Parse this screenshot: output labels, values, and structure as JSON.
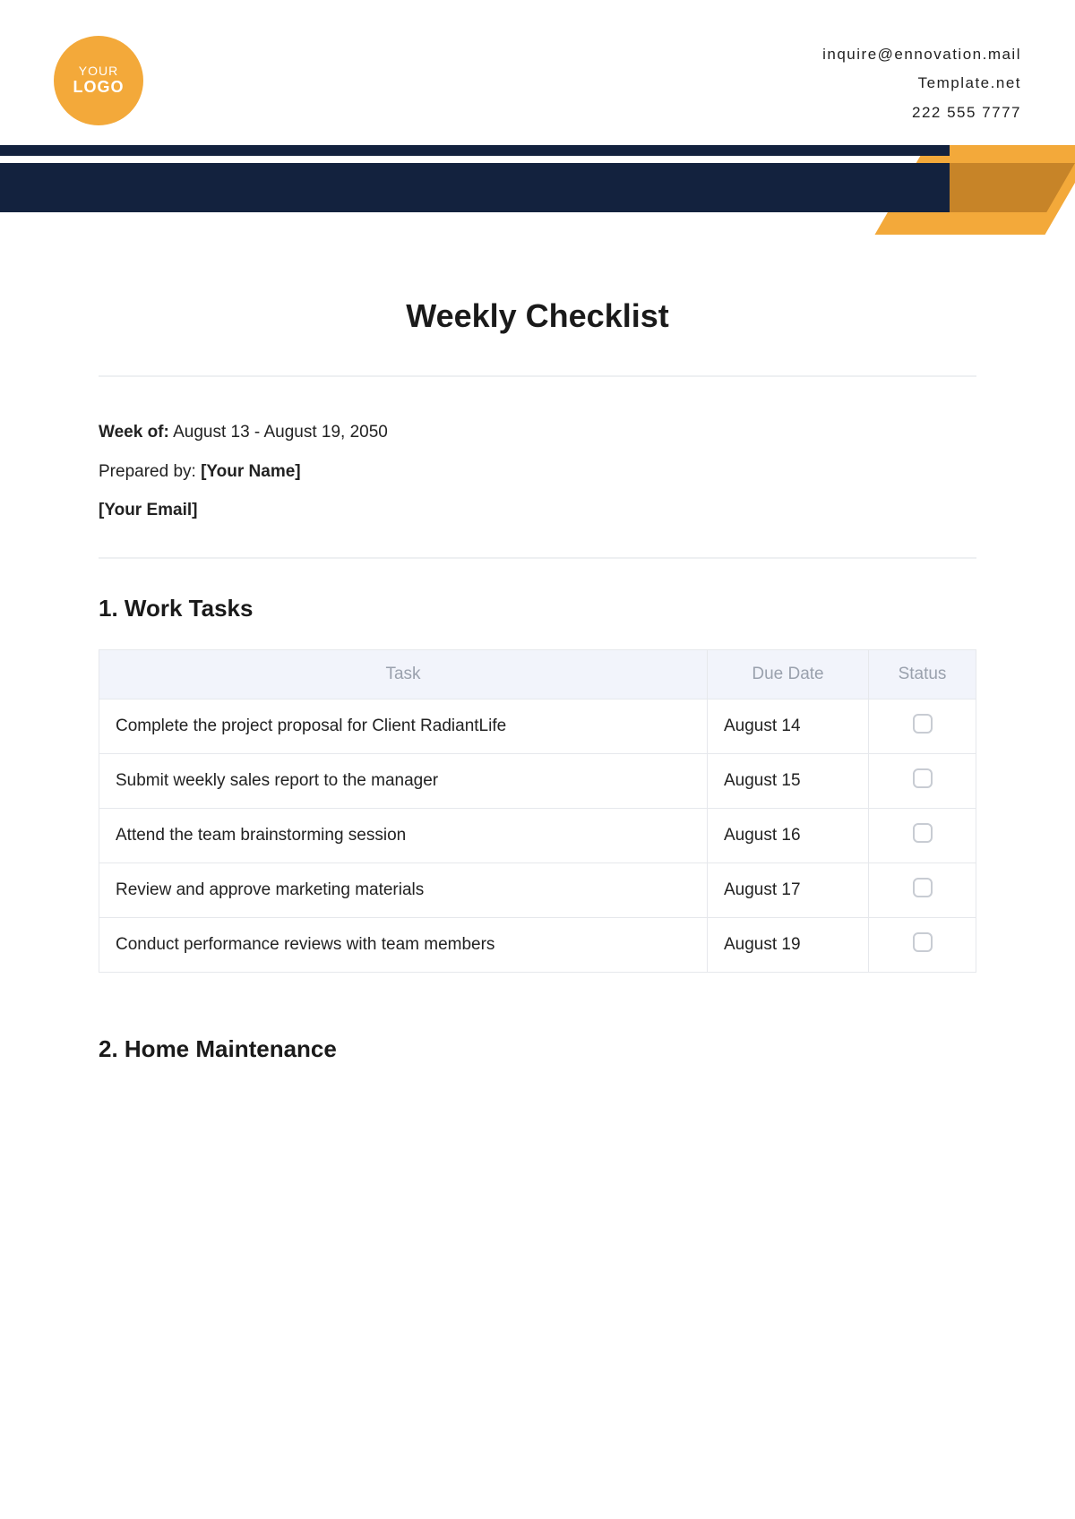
{
  "header": {
    "logo_line1": "YOUR",
    "logo_line2": "LOGO",
    "contact": {
      "email": "inquire@ennovation.mail",
      "site": "Template.net",
      "phone": "222 555 7777"
    }
  },
  "title": "Weekly Checklist",
  "meta": {
    "week_label": "Week of:",
    "week_value": "August 13 - August 19, 2050",
    "prepared_label": "Prepared by:",
    "prepared_value": "[Your Name]",
    "email_value": "[Your Email]"
  },
  "sections": {
    "work": {
      "title": "1. Work Tasks",
      "columns": {
        "task": "Task",
        "due": "Due Date",
        "status": "Status"
      },
      "rows": [
        {
          "task": "Complete the project proposal for Client RadiantLife",
          "due": "August 14"
        },
        {
          "task": "Submit weekly sales report to the manager",
          "due": "August 15"
        },
        {
          "task": "Attend the team brainstorming session",
          "due": "August 16"
        },
        {
          "task": "Review and approve marketing materials",
          "due": "August 17"
        },
        {
          "task": "Conduct performance reviews with team members",
          "due": "August 19"
        }
      ]
    },
    "home": {
      "title": "2. Home Maintenance"
    }
  }
}
